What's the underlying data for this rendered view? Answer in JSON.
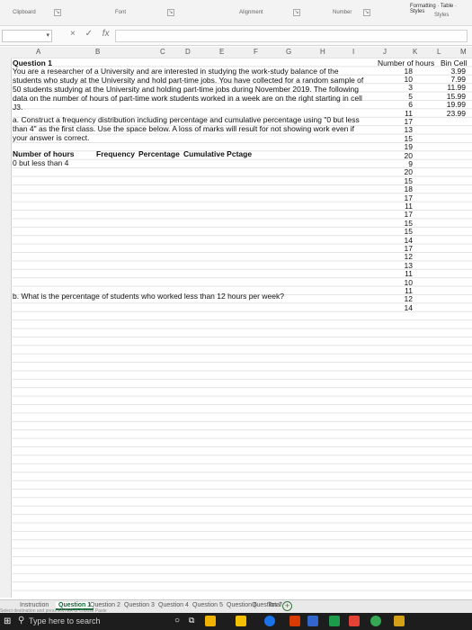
{
  "ribbon": {
    "clipboard": "Clipboard",
    "font": "Font",
    "alignment": "Alignment",
    "number": "Number",
    "formatting": "Formatting",
    "table": "Table",
    "styles_btn": "Styles",
    "styles_group": "Styles"
  },
  "formula_bar": {
    "icons": [
      "×",
      "✓",
      "fx"
    ]
  },
  "columns": [
    "A",
    "B",
    "C",
    "D",
    "E",
    "F",
    "G",
    "H",
    "I",
    "J",
    "K",
    "L",
    "M"
  ],
  "question": {
    "title": "Question 1",
    "paragraph": [
      "You are a researcher of a University and are interested in studying the work-study balance of the",
      "students who study at the University and hold part-time jobs. You have collected for a random sample of",
      "50 students studying at the University and holding part-time jobs during November 2019. The following",
      "data on the number of hours of part-time work students worked in a week are on the right starting in cell",
      "J3."
    ],
    "part_a": [
      "a. Construct a frequency distribution including percentage and cumulative percentage using \"0 but less",
      "than 4\" as the first class. Use the space below. A loss of marks will result for not showing work even if",
      "your answer is correct."
    ],
    "table_headers": [
      "Number of hours",
      "Frequency",
      "Percentage",
      "Cumulative Pctage"
    ],
    "first_class": "0 but less than 4",
    "part_b": "b. What is the percentage of students who worked less than 12 hours per week?"
  },
  "hours_column": {
    "header": "Number of hours",
    "values": [
      "18",
      "10",
      "3",
      "5",
      "6",
      "11",
      "17",
      "13",
      "15",
      "19",
      "20",
      "9",
      "20",
      "15",
      "18",
      "17",
      "11",
      "17",
      "15",
      "15",
      "14",
      "17",
      "12",
      "13",
      "11",
      "10",
      "11",
      "12",
      "14"
    ]
  },
  "bin_column": {
    "header": "Bin Cell",
    "values": [
      "3.99",
      "7.99",
      "11.99",
      "15.99",
      "19.99",
      "23.99"
    ]
  },
  "sheet_tabs": {
    "items": [
      "Instruction",
      "Question 1",
      "Question 2",
      "Question 3",
      "Question 4",
      "Question 5",
      "Question 6",
      "Question 7",
      "Total"
    ],
    "active": "Question 1",
    "add": "+"
  },
  "status_hint": "Select destination and press ENTER or choose Paste",
  "taskbar": {
    "search_placeholder": "Type here to search"
  }
}
